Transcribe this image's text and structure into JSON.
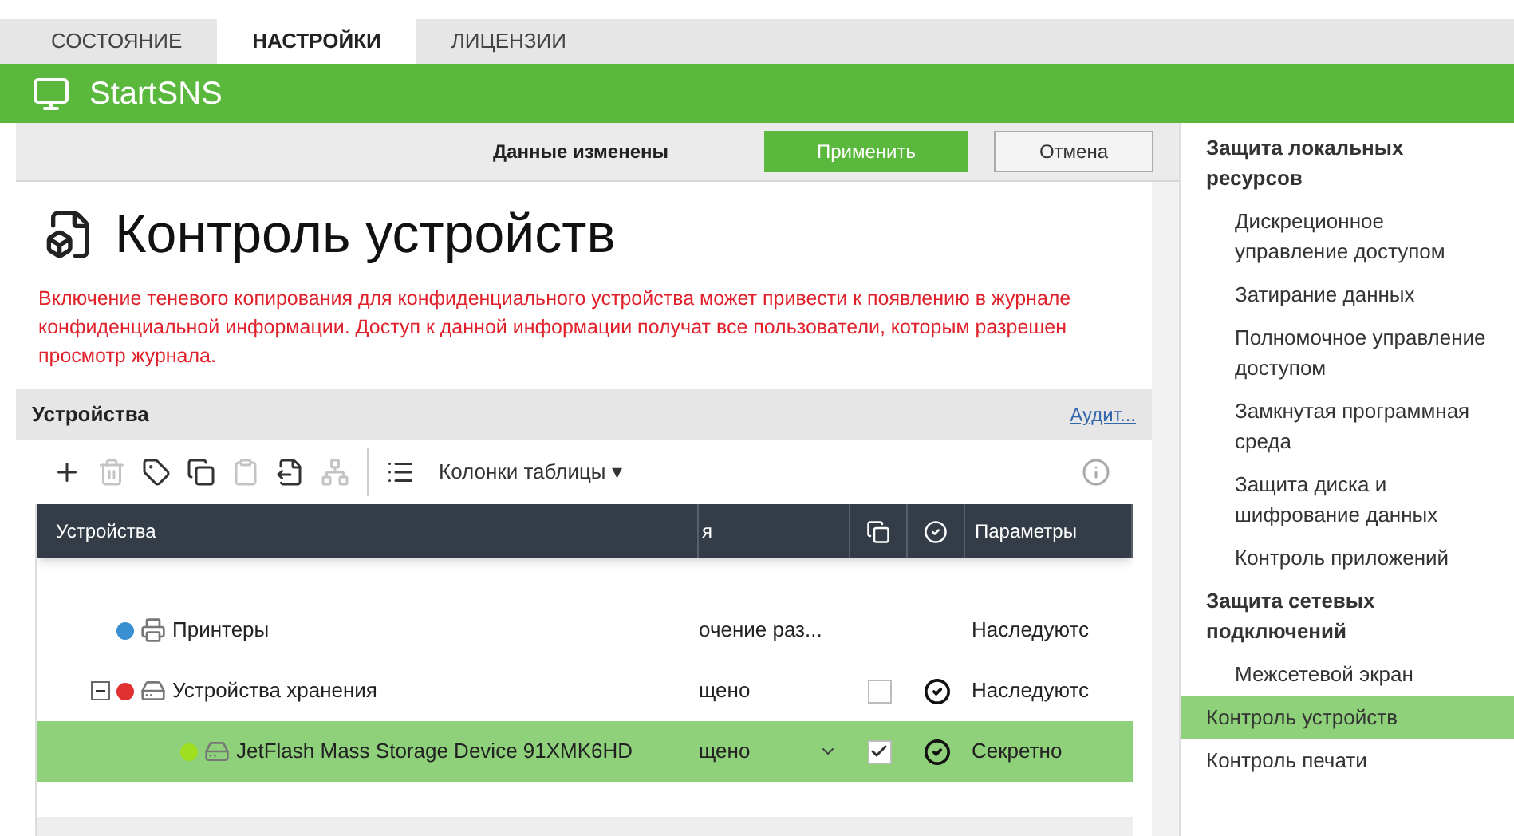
{
  "tabs": [
    {
      "label": "СОСТОЯНИЕ",
      "selected": false
    },
    {
      "label": "НАСТРОЙКИ",
      "selected": true
    },
    {
      "label": "ЛИЦЕНЗИИ",
      "selected": false
    }
  ],
  "header": {
    "title": "StartSNS"
  },
  "action_bar": {
    "status": "Данные изменены",
    "apply": "Применить",
    "cancel": "Отмена"
  },
  "page": {
    "title": "Контроль устройств",
    "warning": "Включение теневого копирования для конфиденциального устройства может привести к появлению в журнале конфиденциальной информации. Доступ к данной информации получат все пользователи, которым разрешен просмотр журнала."
  },
  "panel": {
    "title": "Устройства",
    "link": "Аудит..."
  },
  "toolbar": {
    "buttons": [
      {
        "kind": "add",
        "disabled": false
      },
      {
        "kind": "delete",
        "disabled": true
      },
      {
        "kind": "tag",
        "disabled": false
      },
      {
        "kind": "copy",
        "disabled": false
      },
      {
        "kind": "paste",
        "disabled": true
      },
      {
        "kind": "export",
        "disabled": false
      },
      {
        "kind": "hierarchy",
        "disabled": true
      },
      {
        "kind": "list",
        "disabled": false
      }
    ],
    "columns_menu": "Колонки таблицы ▾"
  },
  "table": {
    "columns": [
      {
        "kind": "text",
        "label": "Устройства"
      },
      {
        "kind": "text",
        "label": "я"
      },
      {
        "kind": "icon-copy"
      },
      {
        "kind": "icon-check"
      },
      {
        "kind": "text",
        "label": "Параметры"
      }
    ],
    "rows": [
      {
        "name": "Принтеры",
        "kind": "printer",
        "color": "#3a8fd0",
        "column_2": "очение раз...",
        "column_5": "Наследуютс",
        "selected": false
      },
      {
        "name": "Устройства хранения",
        "kind": "storage",
        "color": "#e03030",
        "column_2": "щено",
        "shadow_copy": false,
        "checked": true,
        "column_5": "Наследуютс",
        "selected": false,
        "expanded": true,
        "children": [
          {
            "name": "JetFlash Mass Storage Device 91XMK6HD",
            "kind": "storage",
            "color": "#a0e020",
            "column_2": "щено",
            "dropdown": true,
            "shadow_copy": true,
            "checked": true,
            "column_5": "Секретно",
            "selected": true
          }
        ]
      }
    ]
  },
  "sidebar": {
    "sections": [
      {
        "label": "Защита локальных ресурсов",
        "selected": false,
        "children": [
          {
            "label": "Дискреционное управление доступом",
            "selected": false
          },
          {
            "label": "Затирание данных",
            "selected": false
          },
          {
            "label": "Полномочное управление доступом",
            "selected": false
          },
          {
            "label": "Замкнутая программная среда",
            "selected": false
          },
          {
            "label": "Защита диска и шифрование данных",
            "selected": false
          },
          {
            "label": "Контроль приложений",
            "selected": false
          }
        ]
      },
      {
        "label": "Защита сетевых подключений",
        "selected": false,
        "children": [
          {
            "label": "Межсетевой экран",
            "selected": false
          }
        ]
      },
      {
        "label": "Контроль устройств",
        "selected": true
      },
      {
        "label": "Контроль печати",
        "selected": false
      }
    ]
  }
}
